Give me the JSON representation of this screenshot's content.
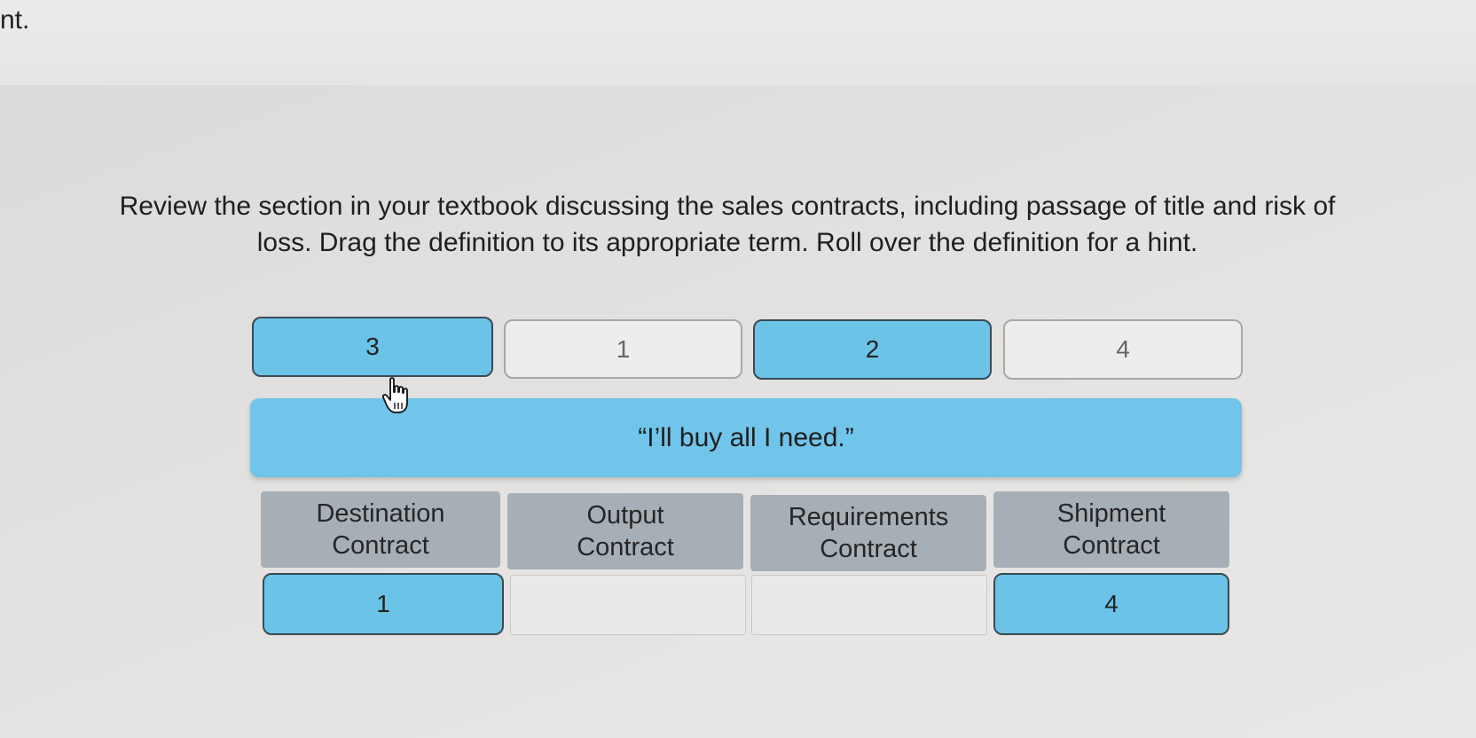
{
  "top_fragment": "nt.",
  "instructions": {
    "line1": "Review the section in your textbook discussing the sales contracts, including passage of title and risk of",
    "line2": "loss. Drag the definition to its appropriate term. Roll over the definition for a hint."
  },
  "number_tiles": [
    {
      "label": "3",
      "state": "filled"
    },
    {
      "label": "1",
      "state": "empty"
    },
    {
      "label": "2",
      "state": "filled"
    },
    {
      "label": "4",
      "state": "empty"
    }
  ],
  "definition": {
    "text": "“I’ll buy all I need.”"
  },
  "terms": [
    {
      "line1": "Destination",
      "line2": "Contract",
      "slot": "1"
    },
    {
      "line1": "Output",
      "line2": "Contract",
      "slot": ""
    },
    {
      "line1": "Requirements",
      "line2": "Contract",
      "slot": ""
    },
    {
      "line1": "Shipment",
      "line2": "Contract",
      "slot": "4"
    }
  ],
  "colors": {
    "tile_filled": "#6cc3e8",
    "definition_bg": "#71c4ea",
    "term_header_bg": "#a6aeb6"
  },
  "icons": {
    "cursor": "hand-pointer-icon"
  }
}
